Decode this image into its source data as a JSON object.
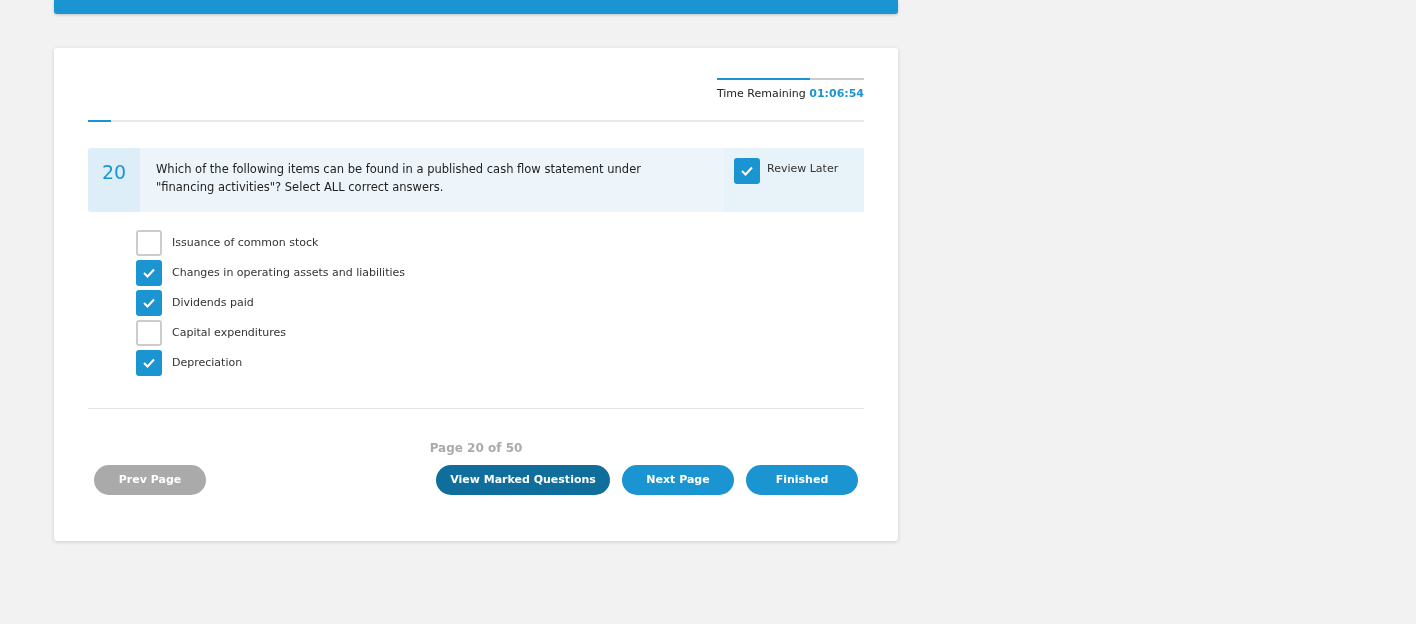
{
  "timer": {
    "label": "Time Remaining",
    "value": "01:06:54",
    "level": 0.63
  },
  "progress": {
    "level": 0.03
  },
  "question": {
    "number": "20",
    "text": "Which of the following items can be found in a published cash flow statement under \"financing activities\"? Select ALL correct answers.",
    "review_later": {
      "label": "Review Later",
      "checked": true
    }
  },
  "answers": [
    {
      "label": "Issuance of common stock",
      "checked": false
    },
    {
      "label": "Changes in operating assets and liabilities",
      "checked": true
    },
    {
      "label": "Dividends paid",
      "checked": true
    },
    {
      "label": "Capital expenditures",
      "checked": false
    },
    {
      "label": "Depreciation",
      "checked": true
    }
  ],
  "page_indicator": "Page 20 of 50",
  "buttons": [
    {
      "label": "Prev Page",
      "kind": "muted"
    },
    {
      "label": "View Marked Questions",
      "kind": "dark"
    },
    {
      "label": "Next Page",
      "kind": "primary"
    },
    {
      "label": "Finished",
      "kind": "primary"
    }
  ]
}
